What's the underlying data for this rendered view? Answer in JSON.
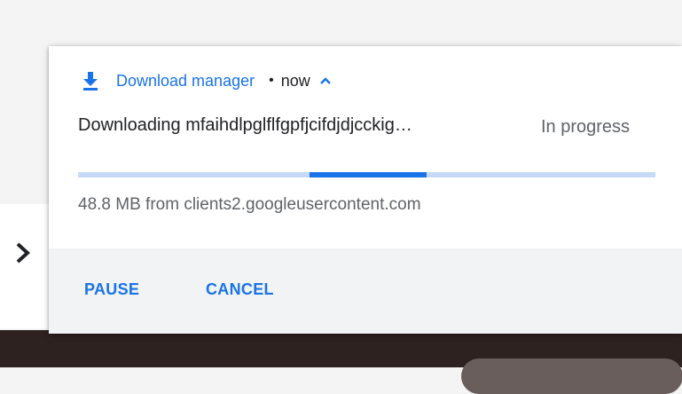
{
  "notification": {
    "app_name": "Download manager",
    "separator": "•",
    "time": "now",
    "title": "Downloading mfaihdlpglflfgpfjcifdjdjcckig…",
    "status": "In progress",
    "detail": "48.8 MB from clients2.googleusercontent.com",
    "progress": {
      "indeterminate": true
    },
    "actions": {
      "pause_label": "PAUSE",
      "cancel_label": "CANCEL"
    },
    "icons": {
      "app": "download-icon",
      "expand": "caret-up-icon",
      "side": "chevron-right-icon"
    }
  },
  "colors": {
    "accent": "#1a73e8",
    "progress_track": "#c6daf7",
    "action_bar": "#f1f3f4",
    "primary_text": "#202124",
    "secondary_text": "#5f6368"
  }
}
